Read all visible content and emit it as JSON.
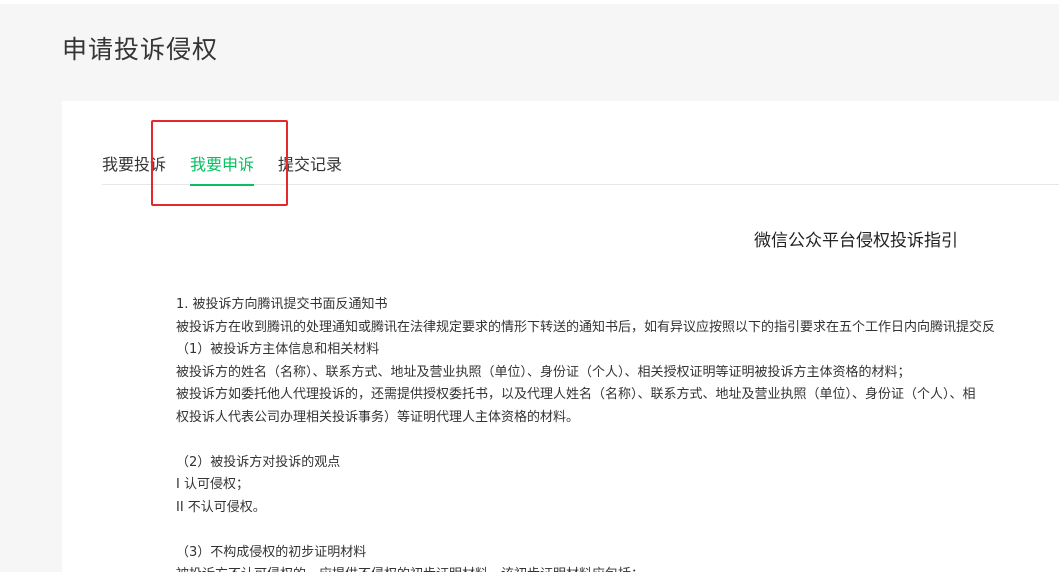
{
  "page": {
    "title": "申请投诉侵权"
  },
  "tabs": [
    {
      "label": "我要投诉",
      "active": false
    },
    {
      "label": "我要申诉",
      "active": true
    },
    {
      "label": "提交记录",
      "active": false
    }
  ],
  "colors": {
    "accent": "#07c160",
    "highlight": "#e5282a",
    "background": "#f6f6f6"
  },
  "document": {
    "title": "微信公众平台侵权投诉指引",
    "lines": [
      "1. 被投诉方向腾讯提交书面反通知书",
      "被投诉方在收到腾讯的处理通知或腾讯在法律规定要求的情形下转送的通知书后，如有异议应按照以下的指引要求在五个工作日内向腾讯提交反",
      "（1）被投诉方主体信息和相关材料",
      "被投诉方的姓名（名称）、联系方式、地址及营业执照（单位）、身份证（个人）、相关授权证明等证明被投诉方主体资格的材料；",
      "被投诉方如委托他人代理投诉的，还需提供授权委托书，以及代理人姓名（名称）、联系方式、地址及营业执照（单位）、身份证（个人）、相",
      "权投诉人代表公司办理相关投诉事务）等证明代理人主体资格的材料。",
      "",
      "（2）被投诉方对投诉的观点",
      "I 认可侵权；",
      "II 不认可侵权。",
      "",
      "（3）不构成侵权的初步证明材料",
      "被投诉方不认可侵权的，应提供不侵权的初步证明材料，该初步证明材料应包括："
    ]
  }
}
